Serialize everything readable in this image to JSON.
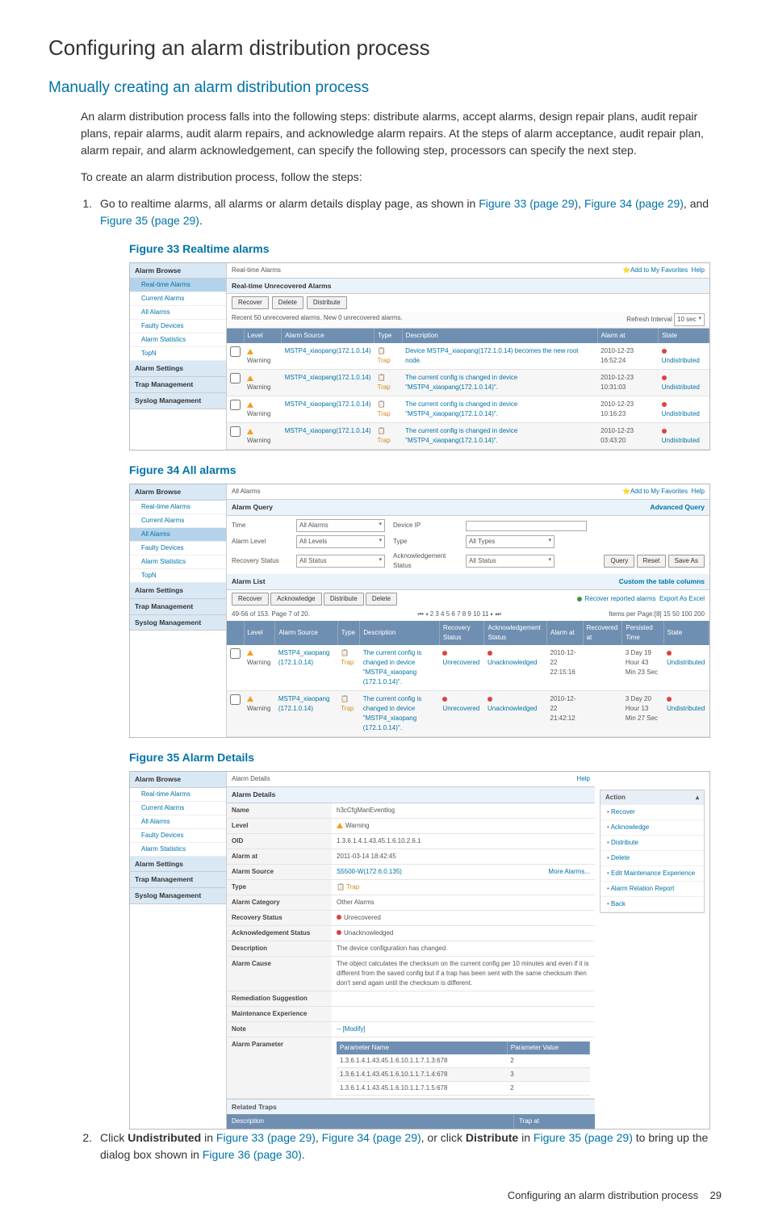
{
  "headings": {
    "h1": "Configuring an alarm distribution process",
    "h2": "Manually creating an alarm distribution process"
  },
  "paragraphs": {
    "intro": "An alarm distribution process falls into the following steps: distribute alarms, accept alarms, design repair plans, audit repair plans, repair alarms, audit alarm repairs, and acknowledge alarm repairs. At the steps of alarm acceptance, audit repair plan, alarm repair, and alarm acknowledgement, can specify the following step, processors can specify the next step.",
    "create": "To create an alarm distribution process, follow the steps:"
  },
  "step1": {
    "prefix": "Go to realtime alarms, all alarms or alarm details display page, as shown in ",
    "links": {
      "a": "Figure 33 (page 29)",
      "b": "Figure 34 (page 29)",
      "c": "Figure 35 (page 29)"
    },
    "comma1": ", ",
    "comma2": ", and ",
    "period": "."
  },
  "step2": {
    "prefix": "Click ",
    "undist": "Undistributed",
    "in": " in ",
    "f33": "Figure 33 (page 29)",
    "c1": ", ",
    "f34": "Figure 34 (page 29)",
    "orclick": ", or click ",
    "dist": "Distribute",
    "in2": " in ",
    "f35": "Figure 35 (page 29)",
    "bringup": " to bring up the dialog box shown in ",
    "f36": "Figure 36 (page 30)",
    "period": "."
  },
  "figures": {
    "f33": {
      "title": "Figure 33 Realtime alarms"
    },
    "f34": {
      "title": "Figure 34 All alarms"
    },
    "f35": {
      "title": "Figure 35 Alarm Details"
    }
  },
  "common": {
    "alarmBrowse": "Alarm Browse",
    "alarmSettings": "Alarm Settings",
    "trapMgmt": "Trap Management",
    "syslogMgmt": "Syslog Management",
    "sidebarItems": [
      "Real-time Alarms",
      "Current Alarms",
      "All Alarms",
      "Faulty Devices",
      "Alarm Statistics",
      "TopN"
    ],
    "addFav": "Add to My Favorites",
    "help": "Help"
  },
  "fig33": {
    "headerTitle": "Real-time Alarms",
    "panelTitle": "Real-time Unrecovered Alarms",
    "btns": [
      "Recover",
      "Delete",
      "Distribute"
    ],
    "recent": "Recent 50 unrecovered alarms. New 0 unrecovered alarms.",
    "refreshLabel": "Refresh Interval",
    "refreshValue": "10 sec",
    "cols": [
      "",
      "Level",
      "Alarm Source",
      "Type",
      "Description",
      "Alarm at",
      "State"
    ],
    "rows": [
      {
        "level": "Warning",
        "source": "MSTP4_xiaopang(172.1.0.14)",
        "type": "Trap",
        "desc": "Device MSTP4_xiaopang(172.1.0.14) becomes the new root node.",
        "date": "2010-12-23 16:52:24",
        "state": "Undistributed"
      },
      {
        "level": "Warning",
        "source": "MSTP4_xiaopang(172.1.0.14)",
        "type": "Trap",
        "desc": "The current config is changed in device \"MSTP4_xiaopang(172.1.0.14)\".",
        "date": "2010-12-23 10:31:03",
        "state": "Undistributed"
      },
      {
        "level": "Warning",
        "source": "MSTP4_xiaopang(172.1.0.14)",
        "type": "Trap",
        "desc": "The current config is changed in device \"MSTP4_xiaopang(172.1.0.14)\".",
        "date": "2010-12-23 10:16:23",
        "state": "Undistributed"
      },
      {
        "level": "Warning",
        "source": "MSTP4_xiaopang(172.1.0.14)",
        "type": "Trap",
        "desc": "The current config is changed in device \"MSTP4_xiaopang(172.1.0.14)\".",
        "date": "2010-12-23 03:43:20",
        "state": "Undistributed"
      }
    ]
  },
  "fig34": {
    "headerTitle": "All Alarms",
    "queryTitle": "Alarm Query",
    "advanced": "Advanced Query",
    "labels": {
      "time": "Time",
      "alarms": "All Alarms",
      "deviceIP": "Device IP",
      "alarmLevel": "Alarm Level",
      "allLevels": "All Levels",
      "type": "Type",
      "allTypes": "All Types",
      "recStatus": "Recovery Status",
      "allStatus": "All Status",
      "ackStatus": "Acknowledgement Status"
    },
    "btns": [
      "Query",
      "Reset",
      "Save As"
    ],
    "listTitle": "Alarm List",
    "customCols": "Custom the table columns",
    "listBtns": [
      "Recover",
      "Acknowledge",
      "Distribute",
      "Delete"
    ],
    "recoverReported": "Recover reported alarms",
    "exportExcel": "Export As Excel",
    "pageLeft": "49-56 of 153. Page 7 of 20.",
    "paginator": "⏮ ◂ 2 3 4 5 6 7 8 9 10 11 ▸ ⏭",
    "itemsPerPage": "Items per Page:[8] 15 50 100 200",
    "cols": [
      "",
      "Level",
      "Alarm Source",
      "Type",
      "Description",
      "Recovery Status",
      "Acknowledgement Status",
      "Alarm at",
      "Recovered at",
      "Persisted Time",
      "State"
    ],
    "rows": [
      {
        "level": "Warning",
        "source": "MSTP4_xiaopang (172.1.0.14)",
        "type": "Trap",
        "desc": "The current config is changed in device \"MSTP4_xiaopang (172.1.0.14)\".",
        "rec": "Unrecovered",
        "ack": "Unacknowledged",
        "alarmAt": "2010-12-22 22:15:16",
        "recAt": "",
        "persist": "3 Day 19 Hour 43 Min 23 Sec",
        "state": "Undistributed"
      },
      {
        "level": "Warning",
        "source": "MSTP4_xiaopang (172.1.0.14)",
        "type": "Trap",
        "desc": "The current config is changed in device \"MSTP4_xiaopang (172.1.0.14)\".",
        "rec": "Unrecovered",
        "ack": "Unacknowledged",
        "alarmAt": "2010-12-22 21:42:12",
        "recAt": "",
        "persist": "3 Day 20 Hour 13 Min 27 Sec",
        "state": "Undistributed"
      }
    ]
  },
  "fig35": {
    "headerTitle": "Alarm Details",
    "helpOnly": "Help",
    "panelTitle": "Alarm Details",
    "fields": {
      "Name": "h3cCfgManEventlog",
      "Level": "Warning",
      "OID": "1.3.6.1.4.1.43.45.1.6.10.2.6.1",
      "Alarm at": "2011-03-14 18:42:45",
      "Alarm Source": "S5500-W(172.6.0.135)",
      "Type": "Trap",
      "Alarm Category": "Other Alarms",
      "Recovery Status": "Unrecovered",
      "Acknowledgement Status": "Unacknowledged",
      "Description": "The device configuration has changed.",
      "Alarm Cause": "The object calculates the checksum on the current config per 10 minutes and even if it is different from the saved config but if a trap has been sent with the same checksum then don't send again until the checksum is different.",
      "Remediation Suggestion": "",
      "Maintenance Experience": "",
      "Note": "-- [Modify]"
    },
    "alarmParamLabel": "Alarm Parameter",
    "moreAlarms": "More Alarms...",
    "paramCols": [
      "Parameter Name",
      "Parameter Value"
    ],
    "paramRows": [
      {
        "n": "1.3.6.1.4.1.43.45.1.6.10.1.1.7.1.3:678",
        "v": "2"
      },
      {
        "n": "1.3.6.1.4.1.43.45.1.6.10.1.1.7.1.4:678",
        "v": "3"
      },
      {
        "n": "1.3.6.1.4.1.43.45.1.6.10.1.1.7.1.5:678",
        "v": "2"
      }
    ],
    "relatedTitle": "Related Traps",
    "relatedCols": [
      "Description",
      "Trap at"
    ],
    "actionTitle": "Action",
    "actions": [
      "Recover",
      "Acknowledge",
      "Distribute",
      "Delete",
      "Edit Maintenance Experience",
      "Alarm Relation Report",
      "Back"
    ]
  },
  "footer": {
    "text": "Configuring an alarm distribution process",
    "page": "29"
  }
}
